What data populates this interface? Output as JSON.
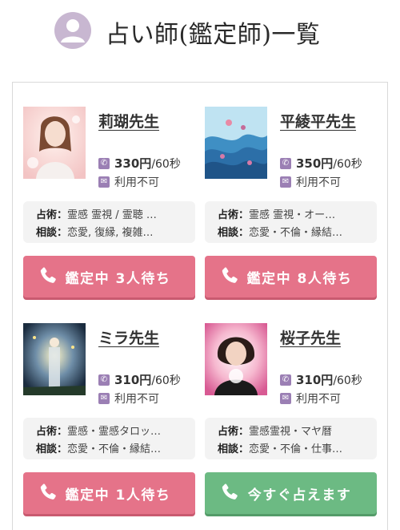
{
  "header": {
    "title": "占い師(鑑定師)一覧",
    "avatar_icon": "user-icon"
  },
  "colors": {
    "accent_purple": "#9b7fb4",
    "button_pink": "#e57389",
    "button_green": "#6cba83"
  },
  "fortune_tellers": [
    {
      "name": "莉瑚先生",
      "price": "330円",
      "unit": "/60秒",
      "availability": "利用不可",
      "divination_label": "占術：",
      "divination": "霊感 霊視 / 霊聴 …",
      "consult_label": "相談：",
      "consult": "恋愛, 復縁, 複雑…",
      "button": "鑑定中 3人待ち",
      "status": "busy"
    },
    {
      "name": "平綾平先生",
      "price": "350円",
      "unit": "/60秒",
      "availability": "利用不可",
      "divination_label": "占術：",
      "divination": "霊感 霊視・オー…",
      "consult_label": "相談：",
      "consult": "恋愛・不倫・縁結…",
      "button": "鑑定中 8人待ち",
      "status": "busy"
    },
    {
      "name": "ミラ先生",
      "price": "310円",
      "unit": "/60秒",
      "availability": "利用不可",
      "divination_label": "占術：",
      "divination": "霊感・霊感タロッ…",
      "consult_label": "相談：",
      "consult": "恋愛・不倫・縁結…",
      "button": "鑑定中 1人待ち",
      "status": "busy"
    },
    {
      "name": "桜子先生",
      "price": "310円",
      "unit": "/60秒",
      "availability": "利用不可",
      "divination_label": "占術：",
      "divination": "霊感霊視・マヤ暦",
      "consult_label": "相談：",
      "consult": "恋愛・不倫・仕事…",
      "button": "今すぐ占えます",
      "status": "available"
    }
  ]
}
